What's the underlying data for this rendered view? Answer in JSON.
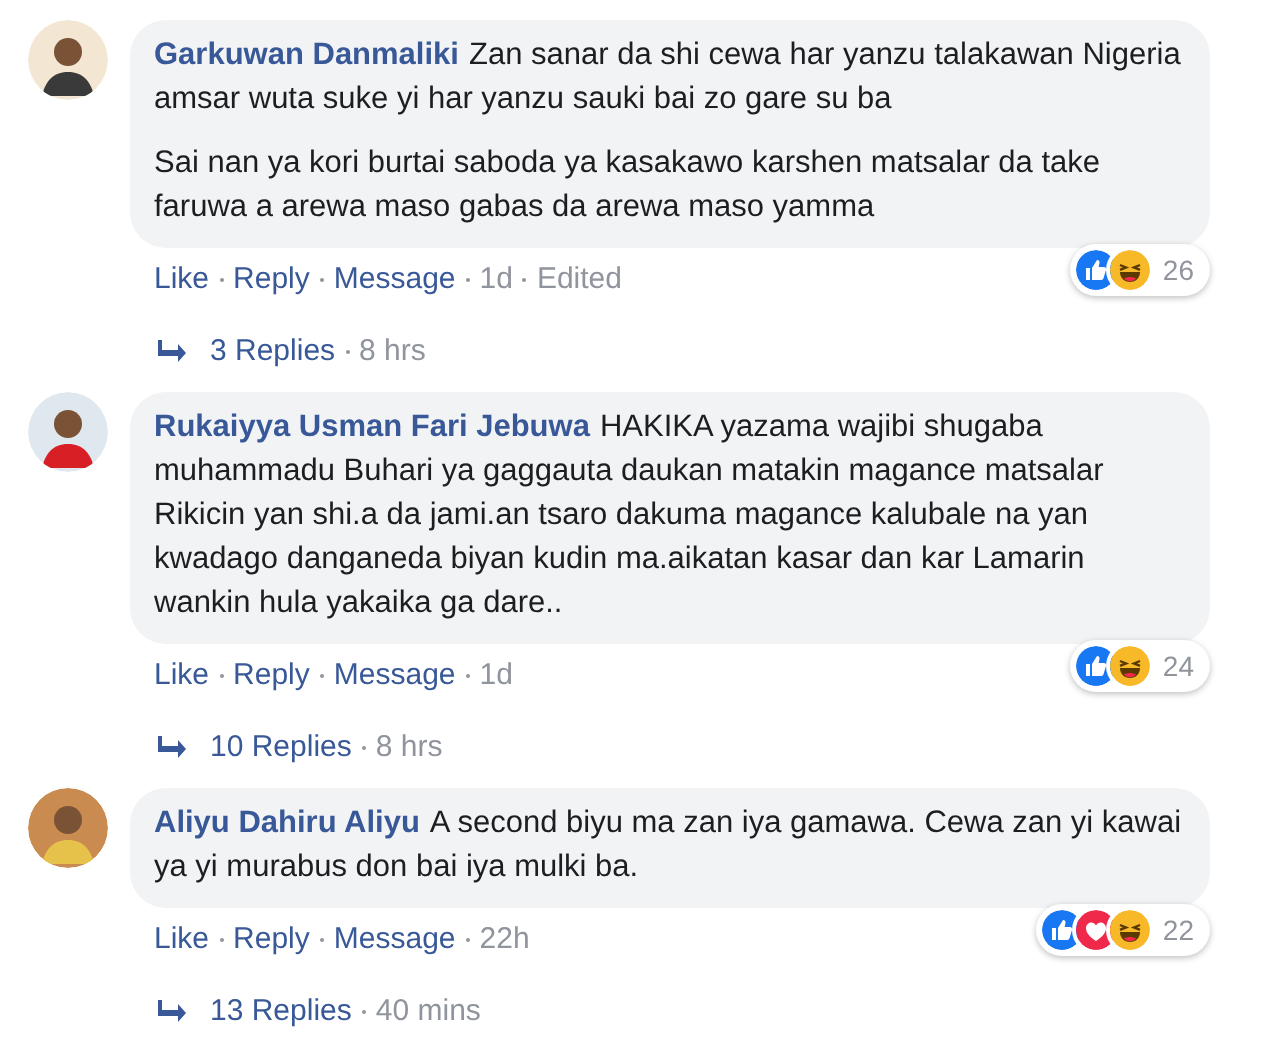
{
  "comments": [
    {
      "author": "Garkuwan Danmaliki",
      "paragraphs": [
        "Zan sanar da shi cewa har yanzu talakawan Nigeria amsar wuta suke yi har yanzu sauki bai zo gare su ba",
        "Sai nan ya kori burtai saboda ya kasakawo karshen matsalar da take faruwa a arewa maso gabas da arewa maso yamma"
      ],
      "reactions": {
        "like": true,
        "love": false,
        "haha": true
      },
      "reaction_count": "26",
      "actions": [
        "Like",
        "Reply",
        "Message"
      ],
      "time": "1d",
      "edited": "Edited",
      "replies": "3 Replies",
      "replies_time": "8 hrs"
    },
    {
      "author": "Rukaiyya Usman Fari Jebuwa",
      "paragraphs": [
        "HAKIKA yazama wajibi shugaba muhammadu Buhari ya gaggauta daukan matakin magance matsalar Rikicin yan shi.a da jami.an tsaro dakuma magance kalubale na yan kwadago danganeda biyan kudin ma.aikatan kasar dan kar Lamarin wankin hula yakaika ga dare.."
      ],
      "reactions": {
        "like": true,
        "love": false,
        "haha": true
      },
      "reaction_count": "24",
      "actions": [
        "Like",
        "Reply",
        "Message"
      ],
      "time": "1d",
      "replies": "10 Replies",
      "replies_time": "8 hrs"
    },
    {
      "author": "Aliyu Dahiru Aliyu",
      "paragraphs": [
        "A second biyu ma zan iya gamawa. Cewa zan yi kawai ya yi murabus don bai iya mulki ba."
      ],
      "reactions": {
        "like": true,
        "love": true,
        "haha": true
      },
      "reaction_count": "22",
      "actions": [
        "Like",
        "Reply",
        "Message"
      ],
      "time": "22h",
      "replies": "13 Replies",
      "replies_time": "40 mins"
    }
  ]
}
